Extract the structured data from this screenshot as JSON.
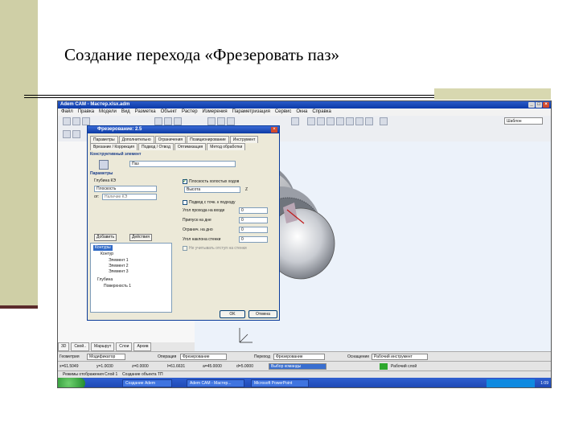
{
  "slide": {
    "title": "Создание перехода «Фрезеровать  паз»"
  },
  "app": {
    "window_title": "Adem CAM - Мастер.xlsx.adm",
    "menu": [
      "Файл",
      "Правка",
      "Модели",
      "Вид",
      "Разметка",
      "Объект",
      "Растер",
      "Измерения",
      "Параметризация",
      "Сервис",
      "Окна",
      "Справка"
    ],
    "toolbar_select": "Шаблон"
  },
  "dialog": {
    "title": "Фрезерование: 2.5",
    "tabs_row1": [
      "Параметры",
      "Дополнительно",
      "Ограничения",
      "Позиционирование",
      "Инструмент"
    ],
    "tabs_row2": [
      "Врезание / Коррекция",
      "Подвод / Отвод",
      "Оптимизация",
      "Метод обработки"
    ],
    "section_construct": "Конструктивный элемент",
    "construct_value": "Паз",
    "section_params": "Параметры",
    "depth_group": "Глубина КЭ",
    "depth_value": "Плоскость",
    "from_label": "от:",
    "from_value": "Наличие КЭ",
    "plane_check": "Плоскость холостых ходов",
    "height_value": "Высота",
    "height_z": "Z",
    "check_pos": "Подвод с точк. к подходу",
    "rows": [
      {
        "label": "Угол прохода на входе",
        "value": "0"
      },
      {
        "label": "Припуск на дне",
        "value": "0"
      },
      {
        "label": "Огранич. на дно",
        "value": "0"
      },
      {
        "label": "Угол наклона стенки",
        "value": "0"
      }
    ],
    "disabled_check": "Не учитывать отступ на стенки",
    "contour_btn": "Добавить",
    "depth_btn": "Действия",
    "tree": [
      "Контуры",
      "Контур",
      "Элемент 1",
      "Элемент 2",
      "Элемент 3",
      "Глубина",
      "Поверхность 1"
    ],
    "ok_label": "OK",
    "cancel_label": "Отмена"
  },
  "panel_tabs": [
    "3D",
    "Свой..",
    "Маршрут",
    "Слои",
    "Архив"
  ],
  "statusbar": {
    "geometry_label": "Геометрия",
    "geometry_value": "Модификатор",
    "operation_label": "Операция",
    "operation_value": "Фрезерование",
    "transition_label": "Переход",
    "transition_value": "Фрезерование",
    "equipment_label": "Оснащение",
    "equipment_value": "Рабочий инструмент"
  },
  "coords": {
    "x": "x=61.5049",
    "y": "y=1.0030",
    "z": "z=0.0000",
    "l": "l=61.6631",
    "a": "a=45.0000",
    "d": "d=5.0000",
    "hint": "Выбор команды",
    "mode_label": "Режимы отображения",
    "layer_label": "Слой 1",
    "state": "Создание объекта ТП",
    "layer_name": "Рабочий слой"
  },
  "taskbar": {
    "items": [
      "Создание Adem",
      "Adem CAM - Мастер...",
      "Microsoft PowerPoint"
    ],
    "clock": "1:09"
  }
}
